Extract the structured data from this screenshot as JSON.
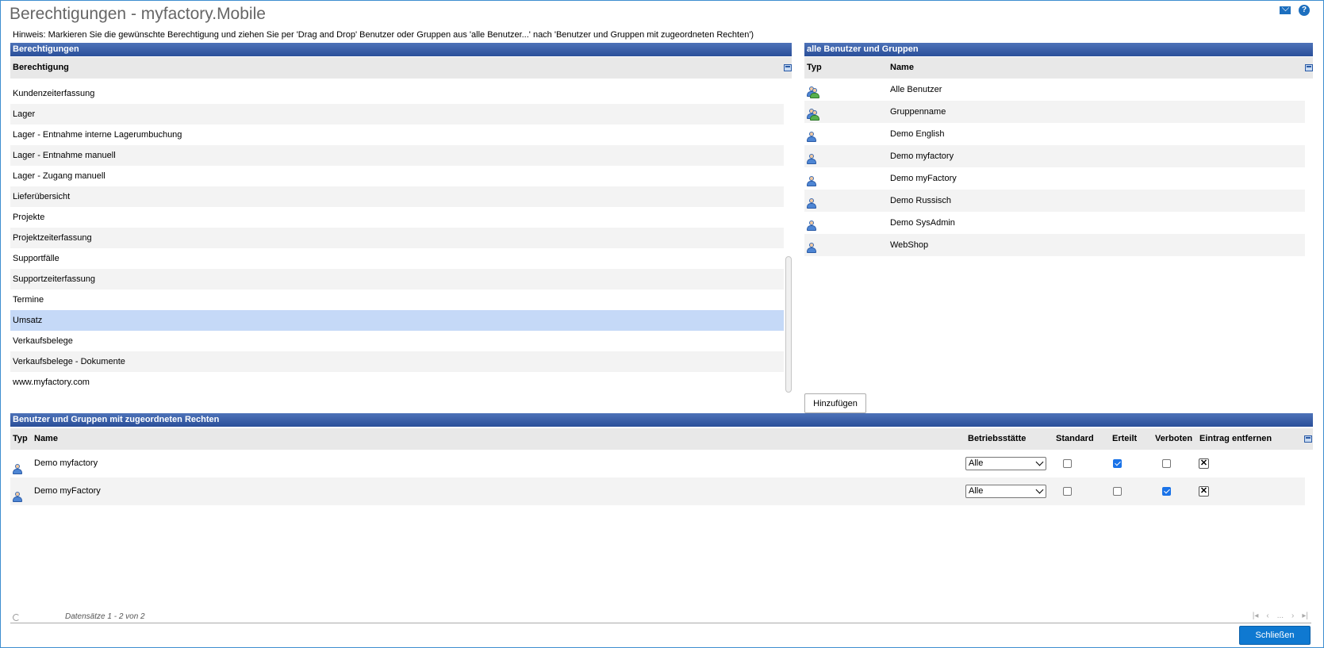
{
  "page": {
    "title": "Berechtigungen - myfactory.Mobile",
    "hint": "Hinweis: Markieren Sie die gewünschte Berechtigung und ziehen Sie per 'Drag and Drop' Benutzer oder Gruppen aus 'alle Benutzer...' nach 'Benutzer und Gruppen mit zugeordneten Rechten')"
  },
  "icons": {
    "mail": "mail-icon",
    "help": "help-icon"
  },
  "permissions": {
    "section_title": "Berechtigungen",
    "column_header": "Berechtigung",
    "items": [
      "Kundenzeiterfassung",
      "Lager",
      "Lager - Entnahme interne Lagerumbuchung",
      "Lager - Entnahme manuell",
      "Lager - Zugang manuell",
      "Lieferübersicht",
      "Projekte",
      "Projektzeiterfassung",
      "Supportfälle",
      "Supportzeiterfassung",
      "Termine",
      "Umsatz",
      "Verkaufsbelege",
      "Verkaufsbelege - Dokumente",
      "www.myfactory.com"
    ],
    "selected": "Umsatz"
  },
  "all_users": {
    "section_title": "alle Benutzer und Gruppen",
    "col_type": "Typ",
    "col_name": "Name",
    "items": [
      {
        "type": "group",
        "name": "Alle Benutzer"
      },
      {
        "type": "group",
        "name": "Gruppenname"
      },
      {
        "type": "user",
        "name": "Demo English"
      },
      {
        "type": "user",
        "name": "Demo myfactory"
      },
      {
        "type": "user",
        "name": "Demo myFactory"
      },
      {
        "type": "user",
        "name": "Demo Russisch"
      },
      {
        "type": "user",
        "name": "Demo SysAdmin"
      },
      {
        "type": "user",
        "name": "WebShop"
      }
    ],
    "add_button": "Hinzufügen"
  },
  "assigned": {
    "section_title": "Benutzer und Gruppen mit zugeordneten Rechten",
    "headers": {
      "type": "Typ",
      "name": "Name",
      "site": "Betriebsstätte",
      "standard": "Standard",
      "granted": "Erteilt",
      "forbidden": "Verboten",
      "remove": "Eintrag entfernen"
    },
    "rows": [
      {
        "type": "user",
        "name": "Demo myfactory",
        "site": "Alle",
        "standard": false,
        "granted": true,
        "forbidden": false
      },
      {
        "type": "user",
        "name": "Demo myFactory",
        "site": "Alle",
        "standard": false,
        "granted": false,
        "forbidden": true
      }
    ],
    "records": "Datensätze 1 - 2 von 2",
    "pager_ellipsis": "..."
  },
  "close_button": "Schließen",
  "colors": {
    "header_blue": "#2a4f99",
    "selection": "#c5d9f7",
    "primary_button": "#0f79d1"
  }
}
